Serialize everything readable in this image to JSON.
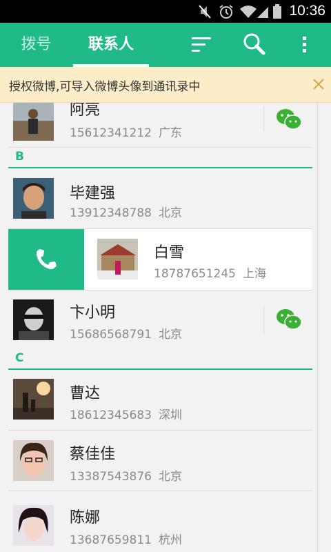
{
  "status_bar": {
    "time": "10:36"
  },
  "tabs": {
    "dial": "拨号",
    "contacts": "联系人"
  },
  "notice": {
    "text": "授权微博,可导入微博头像到通讯录中"
  },
  "contacts": [
    {
      "name": "阿亮",
      "phone": "15612341212",
      "city": "广东",
      "wechat": true
    },
    {
      "section": "B"
    },
    {
      "name": "毕建强",
      "phone": "13912348788",
      "city": "北京",
      "wechat": false
    },
    {
      "name": "白雪",
      "phone": "18787651245",
      "city": "上海",
      "wechat": false,
      "swiped": true
    },
    {
      "name": "卞小明",
      "phone": "15686568791",
      "city": "北京",
      "wechat": true
    },
    {
      "section": "C"
    },
    {
      "name": "曹达",
      "phone": "18612345683",
      "city": "深圳",
      "wechat": false
    },
    {
      "name": "蔡佳佳",
      "phone": "13387543876",
      "city": "北京",
      "wechat": false
    },
    {
      "name": "陈娜",
      "phone": "13687659811",
      "city": "杭州",
      "wechat": false
    }
  ],
  "colors": {
    "accent": "#1fba87",
    "notice_bg": "#fcecc8",
    "wechat": "#3cb034"
  },
  "icons": [
    "mute-icon",
    "alarm-icon",
    "wifi-icon",
    "signal-icon",
    "battery-icon",
    "sort-icon",
    "search-icon",
    "overflow-menu-icon",
    "close-icon",
    "phone-icon",
    "wechat-icon"
  ]
}
